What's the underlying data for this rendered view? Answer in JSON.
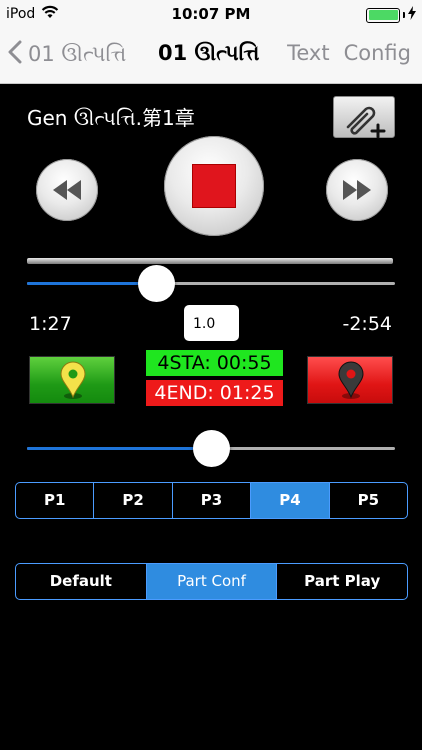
{
  "status": {
    "carrier": "iPod",
    "time": "10:07 PM"
  },
  "nav": {
    "back_label": "01 ઊત્પત્તિ",
    "title": "01 ઊત્પત્તિ",
    "text_label": "Text",
    "config_label": "Config"
  },
  "book_title": "Gen ઊત્પત્તિ.第1章",
  "playback": {
    "elapsed": "1:27",
    "remaining": "-2:54",
    "speed": "1.0",
    "progress": 0.35
  },
  "part": {
    "start_label": "4STA: 00:55",
    "end_label": "4END: 01:25",
    "position": 0.5
  },
  "parts": {
    "items": [
      "P1",
      "P2",
      "P3",
      "P4",
      "P5"
    ],
    "active_index": 3
  },
  "modes": {
    "items": [
      "Default",
      "Part Conf",
      "Part Play"
    ],
    "active_index": 1
  },
  "colors": {
    "accent": "#2f8ce0",
    "start": "#1fe61f",
    "end": "#ee1a1a"
  },
  "icons": [
    "wifi-icon",
    "battery-icon",
    "back-chevron-icon",
    "paperclip-plus-icon",
    "rewind-icon",
    "stop-icon",
    "fast-forward-icon",
    "map-pin-icon"
  ]
}
